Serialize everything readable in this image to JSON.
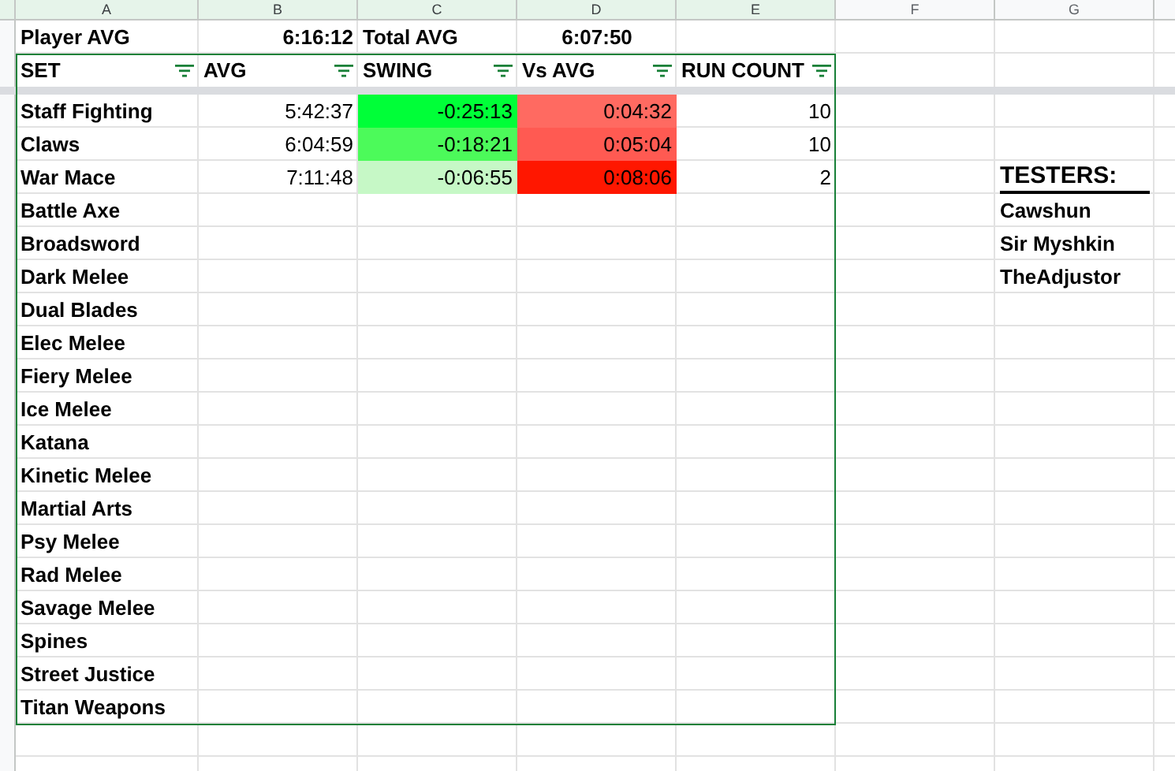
{
  "column_letters": [
    {
      "label": "A",
      "highlighted": true
    },
    {
      "label": "B",
      "highlighted": true
    },
    {
      "label": "C",
      "highlighted": true
    },
    {
      "label": "D",
      "highlighted": true
    },
    {
      "label": "E",
      "highlighted": true
    },
    {
      "label": "F",
      "highlighted": false
    },
    {
      "label": "G",
      "highlighted": false
    }
  ],
  "summary": {
    "player_label": "Player AVG",
    "player_value": "6:16:12",
    "total_label": "Total AVG",
    "total_value": "6:07:50"
  },
  "table": {
    "columns": [
      {
        "label": "SET",
        "filter": true
      },
      {
        "label": "AVG",
        "filter": true
      },
      {
        "label": "SWING",
        "filter": true
      },
      {
        "label": "Vs AVG",
        "filter": true
      },
      {
        "label": "RUN COUNT",
        "filter": true
      }
    ],
    "rows": [
      {
        "set": "Staff Fighting",
        "avg": {
          "text": "5:42:37"
        },
        "swing": {
          "text": "-0:25:13",
          "color": "#00ff38"
        },
        "vs_avg": {
          "text": "0:04:32",
          "color": "#ff6a61"
        },
        "run_count": {
          "text": "10"
        }
      },
      {
        "set": "Claws",
        "avg": {
          "text": "6:04:59"
        },
        "swing": {
          "text": "-0:18:21",
          "color": "#4cfa5a"
        },
        "vs_avg": {
          "text": "0:05:04",
          "color": "#ff5a52"
        },
        "run_count": {
          "text": "10"
        }
      },
      {
        "set": "War Mace",
        "avg": {
          "text": "7:11:48"
        },
        "swing": {
          "text": "-0:06:55",
          "color": "#c6f8c6"
        },
        "vs_avg": {
          "text": "0:08:06",
          "color": "#ff1700"
        },
        "run_count": {
          "text": "2"
        }
      },
      {
        "set": "Battle Axe"
      },
      {
        "set": "Broadsword"
      },
      {
        "set": "Dark Melee"
      },
      {
        "set": "Dual Blades"
      },
      {
        "set": "Elec Melee"
      },
      {
        "set": "Fiery Melee"
      },
      {
        "set": "Ice Melee"
      },
      {
        "set": "Katana"
      },
      {
        "set": "Kinetic Melee"
      },
      {
        "set": "Martial Arts"
      },
      {
        "set": "Psy Melee"
      },
      {
        "set": "Rad Melee"
      },
      {
        "set": "Savage Melee"
      },
      {
        "set": "Spines"
      },
      {
        "set": "Street Justice"
      },
      {
        "set": "Titan Weapons"
      }
    ]
  },
  "testers": {
    "title": "TESTERS:",
    "names": [
      "Cawshun",
      "Sir Myshkin",
      "TheAdjustor"
    ]
  }
}
